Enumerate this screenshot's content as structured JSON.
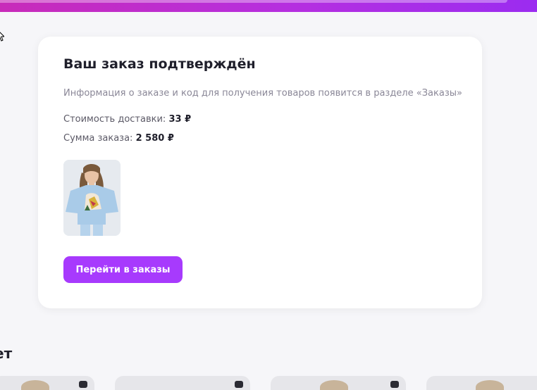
{
  "card": {
    "title": "Ваш заказ подтверждён",
    "info": "Информация о заказе и код для получения товаров появится в разделе «Заказы»",
    "delivery_label": "Стоимость доставки:",
    "delivery_value": "33 ₽",
    "total_label": "Сумма заказа:",
    "total_value": "2 580 ₽",
    "button_label": "Перейти в заказы"
  },
  "section": {
    "title_fragment": "ет"
  },
  "colors": {
    "accent": "#a73afd",
    "gradient_start": "#c82bb9",
    "gradient_end": "#9b2cf0"
  }
}
